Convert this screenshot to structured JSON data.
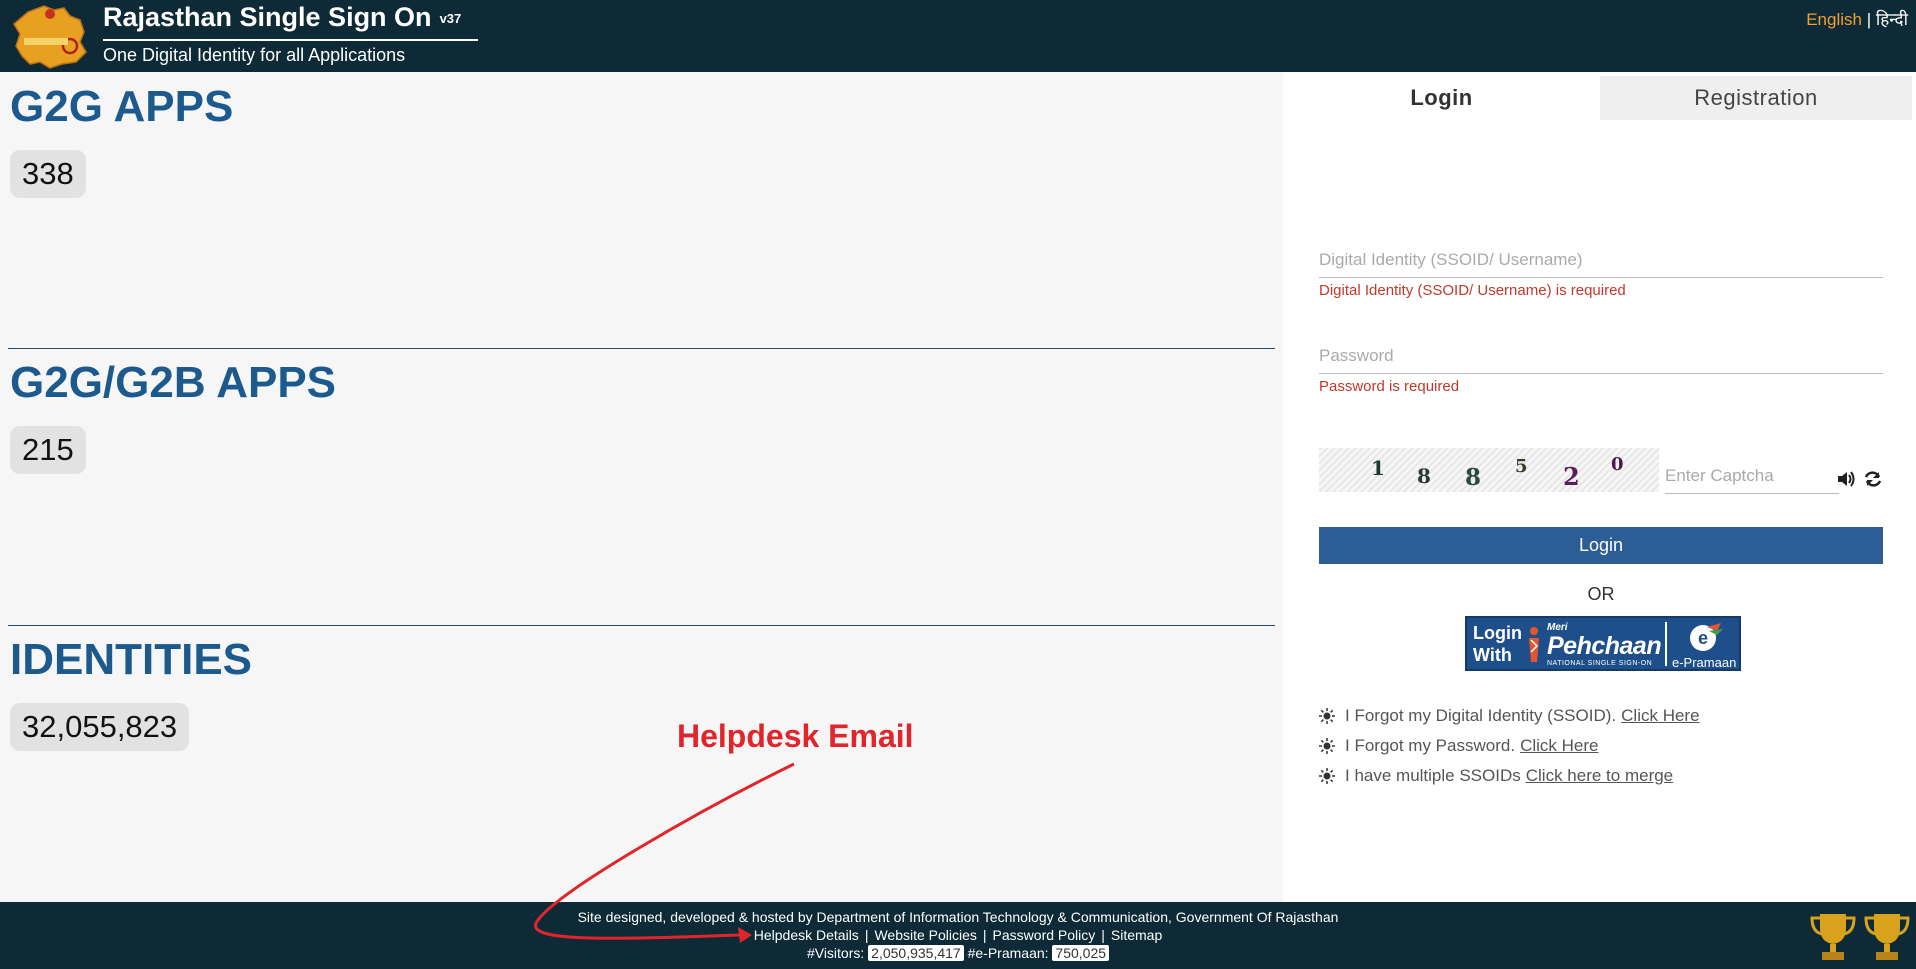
{
  "header": {
    "title": "Rajasthan Single Sign On",
    "version": "v37",
    "subtitle": "One Digital Identity for all Applications",
    "lang_english": "English",
    "lang_separator": "|",
    "lang_hindi": "हिन्दी"
  },
  "stats": [
    {
      "title": "G2G APPS",
      "count": "338"
    },
    {
      "title": "G2G/G2B APPS",
      "count": "215"
    },
    {
      "title": "IDENTITIES",
      "count": "32,055,823"
    }
  ],
  "login_panel": {
    "tabs": {
      "login": "Login",
      "registration": "Registration"
    },
    "username_placeholder": "Digital Identity (SSOID/ Username)",
    "username_error": "Digital Identity (SSOID/ Username) is required",
    "password_placeholder": "Password",
    "password_error": "Password is required",
    "captcha_digits": [
      "1",
      "8",
      "8",
      "5",
      "2",
      "0"
    ],
    "captcha_placeholder": "Enter Captcha",
    "login_button": "Login",
    "or_text": "OR",
    "pehchaan": {
      "line1": "Login",
      "line2": "With",
      "meri": "Meri",
      "name": "Pehchaan",
      "tagline": "NATIONAL SINGLE SIGN-ON",
      "epramaan": "e-Pramaan"
    },
    "help_links": [
      {
        "text": "I Forgot my Digital Identity (SSOID).",
        "link": "Click Here"
      },
      {
        "text": "I Forgot my Password.",
        "link": "Click Here"
      },
      {
        "text": "I have multiple SSOIDs",
        "link": "Click here to merge"
      }
    ]
  },
  "footer": {
    "credit": "Site designed, developed & hosted by Department of Information Technology & Communication, Government Of Rajasthan",
    "links": [
      "Helpdesk Details",
      "Website Policies",
      "Password Policy",
      "Sitemap"
    ],
    "link_separator": "|",
    "visitors_label": "#Visitors:",
    "visitors_count": "2,050,935,417",
    "epramaan_label": "#e-Pramaan:",
    "epramaan_count": "750,025"
  },
  "annotation": {
    "label": "Helpdesk Email",
    "color": "#e0262b"
  }
}
